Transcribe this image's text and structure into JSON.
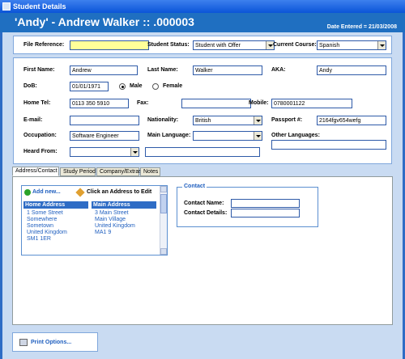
{
  "window": {
    "title": "Student Details"
  },
  "header": {
    "title": "'Andy' - Andrew Walker ::        .000003",
    "date_entered": "Date Entered = 21/03/2008"
  },
  "top_panel": {
    "file_reference_label": "File Reference:",
    "file_reference_value": "",
    "student_status_label": "Student Status:",
    "student_status_value": "Student with Offer",
    "current_course_label": "Current Course:",
    "current_course_value": "Spanish"
  },
  "details": {
    "first_name_label": "First Name:",
    "first_name": "Andrew",
    "last_name_label": "Last Name:",
    "last_name": "Walker",
    "aka_label": "AKA:",
    "aka": "Andy",
    "dob_label": "DoB:",
    "dob": "01/01/1971",
    "male_label": "Male",
    "female_label": "Female",
    "gender": "Male",
    "home_tel_label": "Home Tel:",
    "home_tel": "0113 350 5910",
    "fax_label": "Fax:",
    "fax": "",
    "mobile_label": "Mobile:",
    "mobile": "0780001122",
    "email_label": "E-mail:",
    "email": "",
    "nationality_label": "Nationality:",
    "nationality": "British",
    "passport_label": "Passport #:",
    "passport": "2164fgv654wefg",
    "occupation_label": "Occupation:",
    "occupation": "Software Engineer",
    "main_language_label": "Main Language:",
    "main_language": "",
    "other_languages_label": "Other Languages:",
    "other_languages": "",
    "heard_from_label": "Heard From:",
    "heard_from": "",
    "heard_from_detail": ""
  },
  "tabs": [
    {
      "label": "Address/Contact"
    },
    {
      "label": "Study Period"
    },
    {
      "label": "Company/Extras"
    },
    {
      "label": "Notes"
    }
  ],
  "address": {
    "add_new_label": "Add new...",
    "click_to_edit_label": "Click an Address to Edit",
    "home_header": "Home Address",
    "home_lines": "1 Some Street\nSomewhere\nSometown\nUnited Kingdom\nSM1 1ER",
    "main_header": "Main Address",
    "main_lines": "3 Main Street\nMain Village\nUnited Kingdom\nMA1 9"
  },
  "contact": {
    "legend": "Contact",
    "name_label": "Contact Name:",
    "name": "",
    "details_label": "Contact Details:",
    "details": ""
  },
  "footer": {
    "print_label": "Print Options..."
  },
  "colors": {
    "header_bg": "#1f6fc1",
    "frame_bg": "#c9dbf2",
    "accent_text": "#1f5fbf"
  }
}
